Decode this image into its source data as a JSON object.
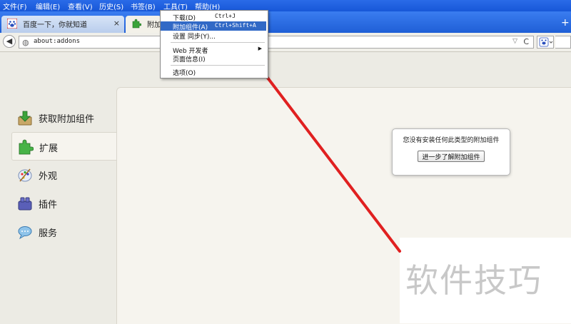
{
  "menubar": {
    "items": [
      "文件(F)",
      "编辑(E)",
      "查看(V)",
      "历史(S)",
      "书签(B)",
      "工具(T)",
      "帮助(H)"
    ]
  },
  "tabs": [
    {
      "title": "百度一下，你就知道",
      "close": "×"
    },
    {
      "title": "附加组件"
    }
  ],
  "new_tab": "+",
  "navbar": {
    "url": "about:addons",
    "back": "◀",
    "dropdown": "▽",
    "reload": "C"
  },
  "tools_menu": {
    "items": [
      {
        "label": "下载(D)",
        "shortcut": "Ctrl+J"
      },
      {
        "label": "附加组件(A)",
        "shortcut": "Ctrl+Shift+A",
        "highlighted": true
      },
      {
        "label": "设置 同步(Y)..."
      },
      {
        "label": "Web 开发者",
        "submenu": "▶"
      },
      {
        "label": "页面信息(I)"
      },
      {
        "label": "选项(O)"
      }
    ]
  },
  "sidebar": {
    "items": [
      {
        "label": "获取附加组件",
        "icon": "download-addon-icon"
      },
      {
        "label": "扩展",
        "icon": "puzzle-icon",
        "selected": true
      },
      {
        "label": "外观",
        "icon": "palette-icon"
      },
      {
        "label": "插件",
        "icon": "plugin-block-icon"
      },
      {
        "label": "服务",
        "icon": "speech-bubble-icon"
      }
    ]
  },
  "empty_notice": {
    "text": "您没有安装任何此类型的附加组件",
    "button": "进一步了解附加组件"
  },
  "watermark": "软件技巧",
  "colors": {
    "menubar": "#1f5fd6",
    "highlight": "#3169c6",
    "arrow": "#e02020",
    "panel": "#f6f4ee",
    "sidebar": "#ecebe4"
  }
}
